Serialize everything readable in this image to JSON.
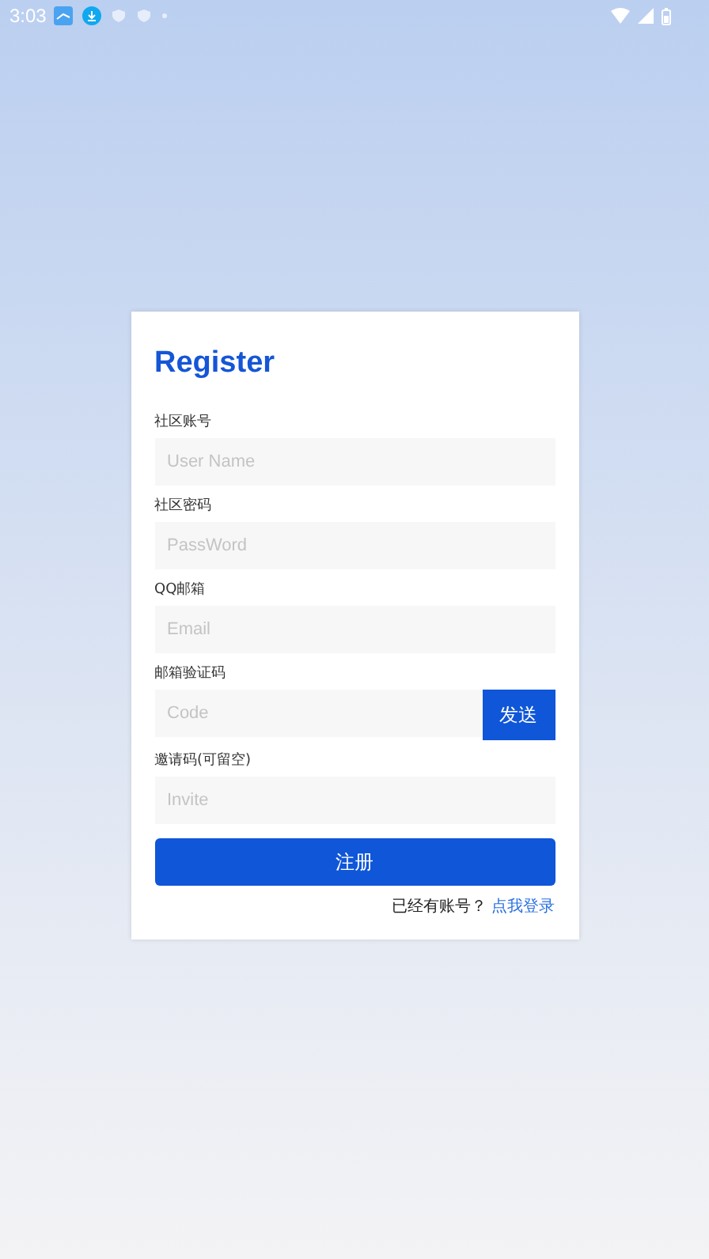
{
  "status_bar": {
    "time": "3:03"
  },
  "form": {
    "title": "Register",
    "fields": [
      {
        "kind": "field",
        "label": "社区账号",
        "placeholder": "User Name"
      },
      {
        "kind": "field",
        "label": "社区密码",
        "placeholder": "PassWord"
      },
      {
        "kind": "field",
        "label": "QQ邮箱",
        "placeholder": "Email"
      },
      {
        "kind": "field-with-button",
        "label": "邮箱验证码",
        "placeholder": "Code",
        "button": "发送"
      },
      {
        "kind": "field",
        "label": "邀请码(可留空)",
        "placeholder": "Invite"
      }
    ],
    "submit": "注册",
    "login_prompt": "已经有账号？",
    "login_link": "点我登录"
  }
}
